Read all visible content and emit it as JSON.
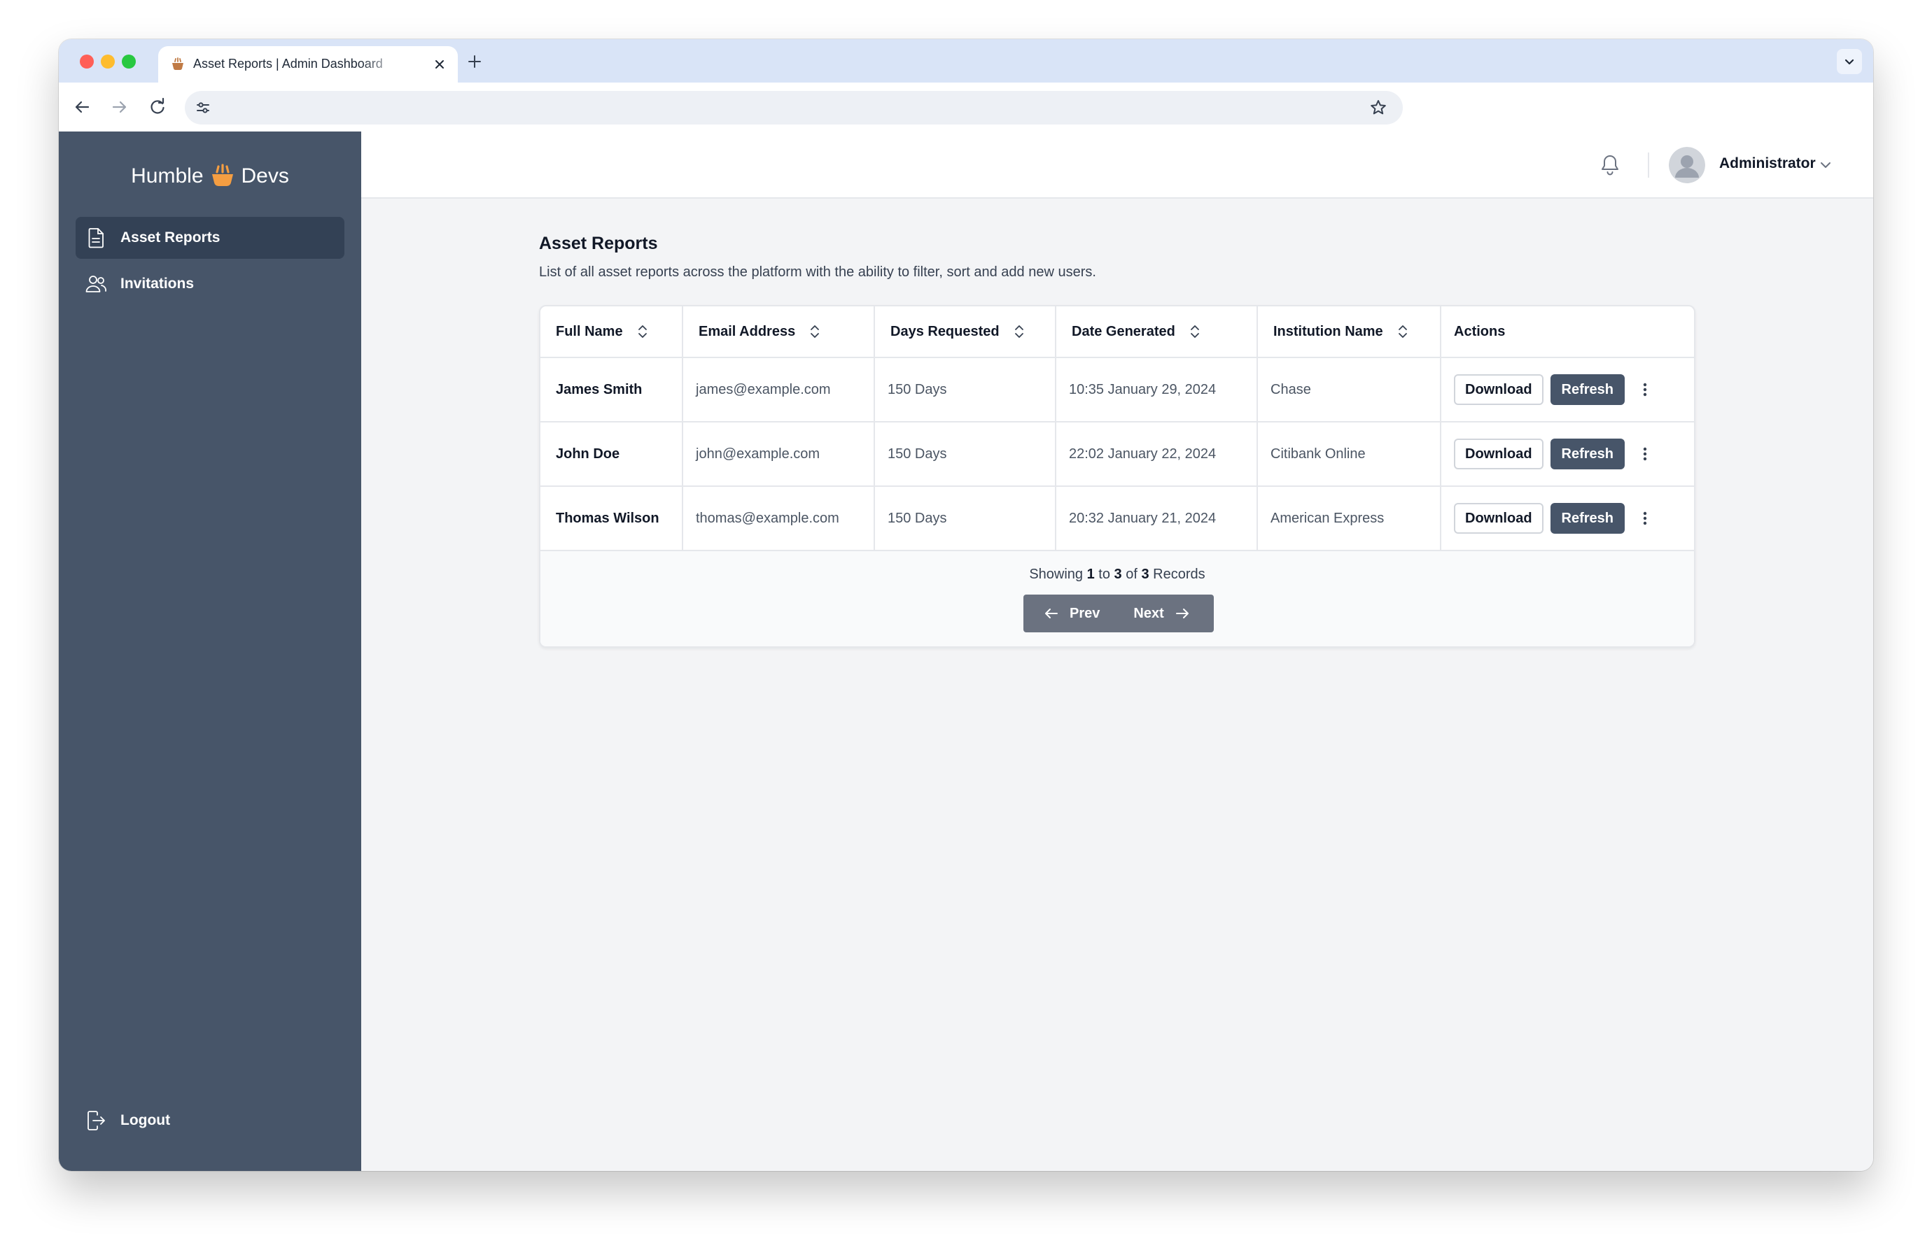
{
  "browser": {
    "tab_title": "Asset Reports | Admin Dashboard",
    "url": ""
  },
  "sidebar": {
    "brand_left": "Humble",
    "brand_right": "Devs",
    "items": [
      {
        "label": "Asset Reports",
        "icon": "document-icon",
        "active": true
      },
      {
        "label": "Invitations",
        "icon": "users-icon",
        "active": false
      }
    ],
    "logout_label": "Logout"
  },
  "header": {
    "user_name": "Administrator"
  },
  "page": {
    "title": "Asset Reports",
    "description": "List of all asset reports across the platform with the ability to filter, sort and add new users."
  },
  "table": {
    "columns": [
      "Full Name",
      "Email Address",
      "Days Requested",
      "Date Generated",
      "Institution Name",
      "Actions"
    ],
    "rows": [
      {
        "name": "James Smith",
        "email": "james@example.com",
        "days": "150 Days",
        "date": "10:35 January 29, 2024",
        "institution": "Chase"
      },
      {
        "name": "John Doe",
        "email": "john@example.com",
        "days": "150 Days",
        "date": "22:02 January 22, 2024",
        "institution": "Citibank Online"
      },
      {
        "name": "Thomas Wilson",
        "email": "thomas@example.com",
        "days": "150 Days",
        "date": "20:32 January 21, 2024",
        "institution": "American Express"
      }
    ],
    "download_label": "Download",
    "refresh_label": "Refresh"
  },
  "pagination": {
    "showing_prefix": "Showing",
    "from": "1",
    "to_word": "to",
    "to": "3",
    "of_word": "of",
    "total": "3",
    "suffix": "Records",
    "prev_label": "Prev",
    "next_label": "Next"
  },
  "colors": {
    "sidebar_bg": "#475569",
    "sidebar_active": "#334155",
    "accent_button": "#475569",
    "pager_bg": "#6b7280",
    "brand_mark": "#f59e42"
  }
}
